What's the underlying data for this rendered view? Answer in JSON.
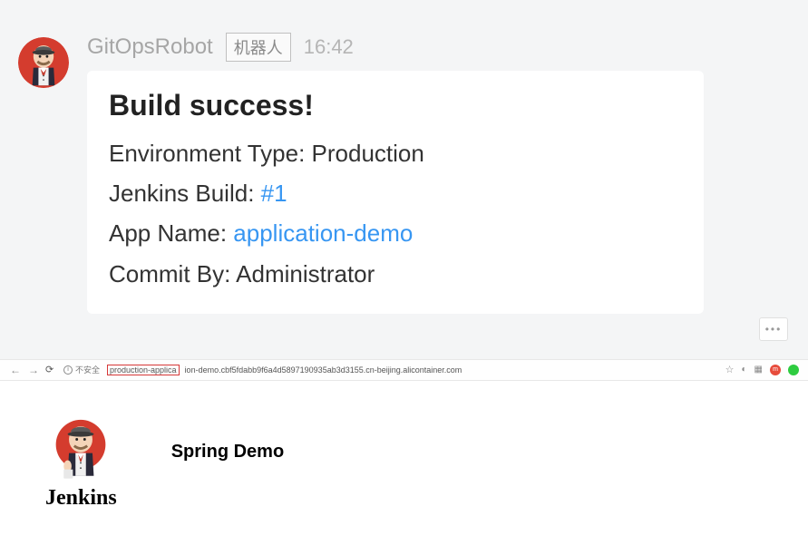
{
  "chat": {
    "sender": "GitOpsRobot",
    "bot_badge": "机器人",
    "timestamp": "16:42",
    "card": {
      "title": "Build success!",
      "env_label": "Environment Type: ",
      "env_value": "Production",
      "build_label": "Jenkins Build: ",
      "build_value": "#1",
      "app_label": "App Name: ",
      "app_value": "application-demo",
      "commit_label": "Commit By: ",
      "commit_value": "Administrator"
    },
    "more": "•••"
  },
  "browser": {
    "insecure_label": "不安全",
    "url_highlighted": "production-applica",
    "url_rest": "ion-demo.cbf5fdabb9f6a4d5897190935ab3d3155.cn-beijing.alicontainer.com"
  },
  "page": {
    "logo_text": "Jenkins",
    "title": "Spring Demo"
  }
}
